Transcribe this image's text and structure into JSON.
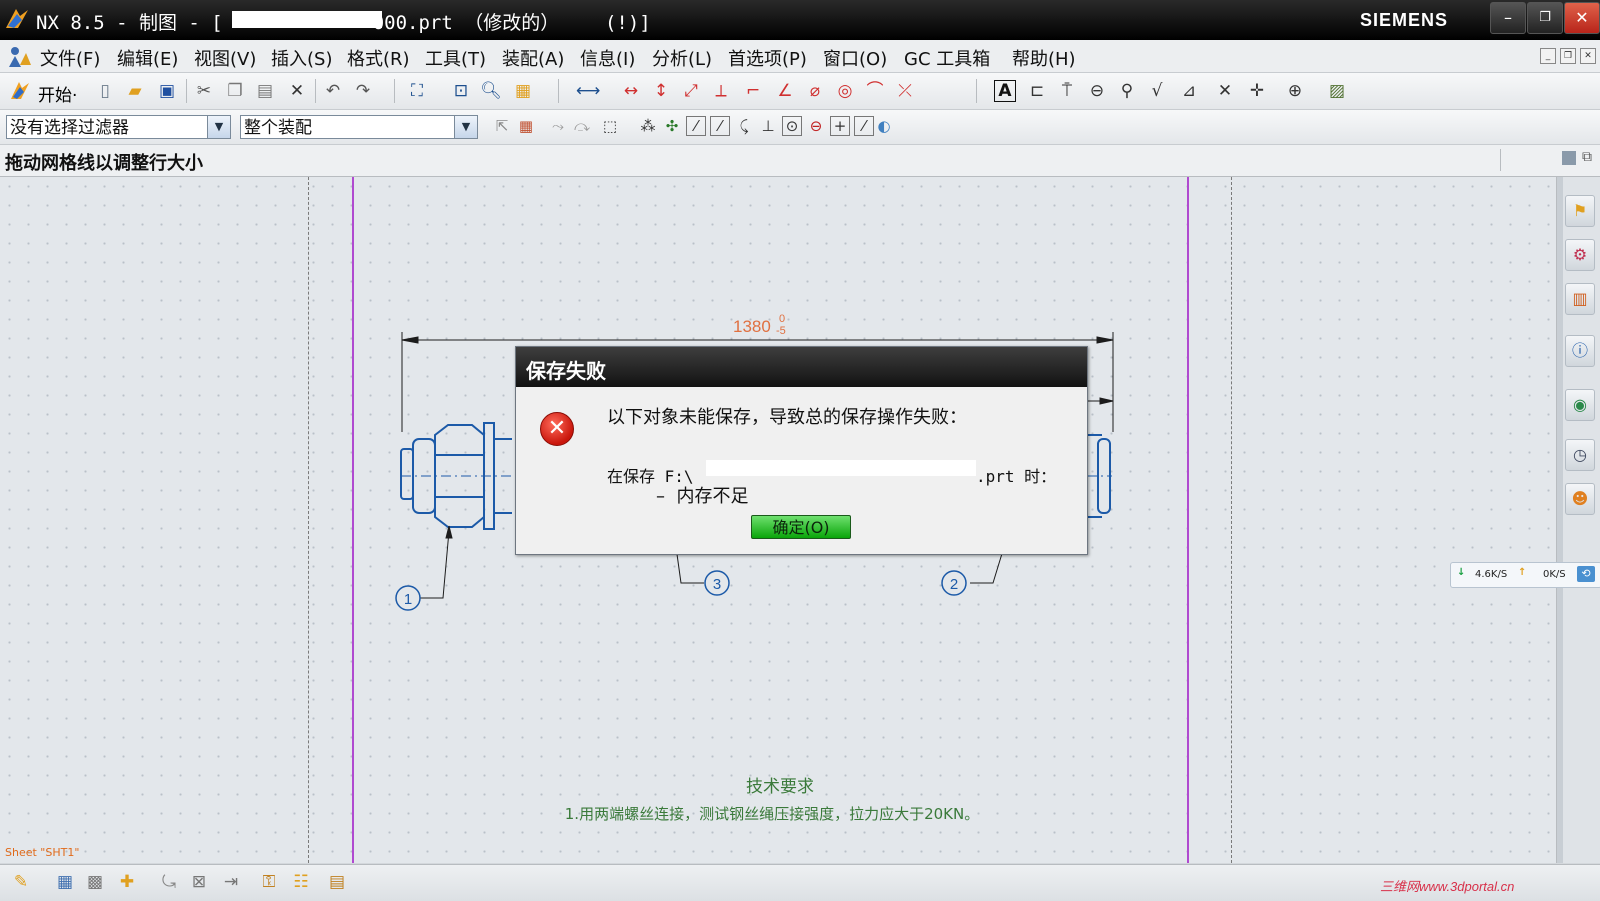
{
  "window": {
    "title": "NX 8.5 - 制图 - [",
    "title_suffix": "000.prt （修改的）    (!)]",
    "brand": "SIEMENS",
    "minimize": "–",
    "restore": "❐",
    "close": "✕"
  },
  "menu": [
    "文件(F)",
    "编辑(E)",
    "视图(V)",
    "插入(S)",
    "格式(R)",
    "工具(T)",
    "装配(A)",
    "信息(I)",
    "分析(L)",
    "首选项(P)",
    "窗口(O)",
    "GC 工具箱",
    "帮助(H)"
  ],
  "toolbar": {
    "start_label": "开始·",
    "filter_value": "没有选择过滤器",
    "scope_value": "整个装配"
  },
  "cue_line": "拖动网格线以调整行大小",
  "drawing": {
    "dimension": "1380",
    "tol_upper": "0",
    "tol_lower": "-5",
    "balloons": [
      "1",
      "3",
      "2"
    ],
    "notes_title": "技术要求",
    "notes_line1": "1.用两端螺丝连接，测试钢丝绳压接强度，拉力应大于20KN。",
    "sheet_label": "Sheet \"SHT1\""
  },
  "dialog": {
    "title": "保存失败",
    "message": "以下对象未能保存，导致总的保存操作失败：",
    "saving_prefix": "在保存 F:\\",
    "saving_suffix": ".prt 时：",
    "reason": "–  内存不足",
    "ok_label": "确定(O)",
    "icon": "error-icon"
  },
  "network": {
    "down": "4.6K/S",
    "up": "0K/S"
  },
  "watermark": "三维网www.3dportal.cn",
  "colors": {
    "border_magenta": "#b04ad0",
    "drawing_blue": "#1c5aa8",
    "ok_green": "#22b022"
  }
}
